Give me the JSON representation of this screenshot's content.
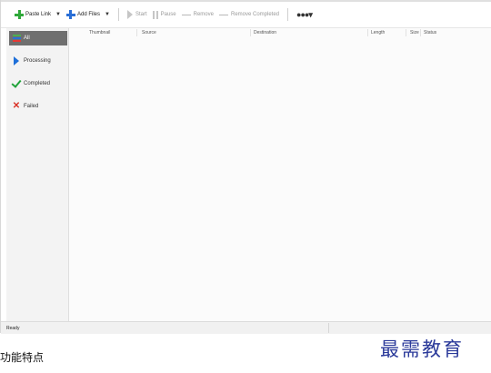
{
  "toolbar": {
    "paste_link": "Paste Link",
    "add_files": "Add Files",
    "start": "Start",
    "pause": "Pause",
    "remove": "Remove",
    "remove_completed": "Remove Completed",
    "more": "●●●▾"
  },
  "sidebar": {
    "items": [
      {
        "label": "All",
        "icon": "all-list-icon",
        "active": true
      },
      {
        "label": "Processing",
        "icon": "play-icon",
        "active": false
      },
      {
        "label": "Completed",
        "icon": "check-icon",
        "active": false
      },
      {
        "label": "Failed",
        "icon": "x-icon",
        "active": false
      }
    ]
  },
  "table": {
    "columns": [
      "Thumbnail",
      "Source",
      "Destination",
      "Length",
      "Size",
      "Status"
    ]
  },
  "statusbar": {
    "text": "Ready"
  },
  "below": {
    "caption": "功能特点",
    "brand": "最需教育"
  },
  "colors": {
    "green": "#2fa83a",
    "blue": "#2a6fd6",
    "red": "#d93025",
    "active_nav": "#6f6f6f",
    "brand": "#2b3a9a"
  }
}
